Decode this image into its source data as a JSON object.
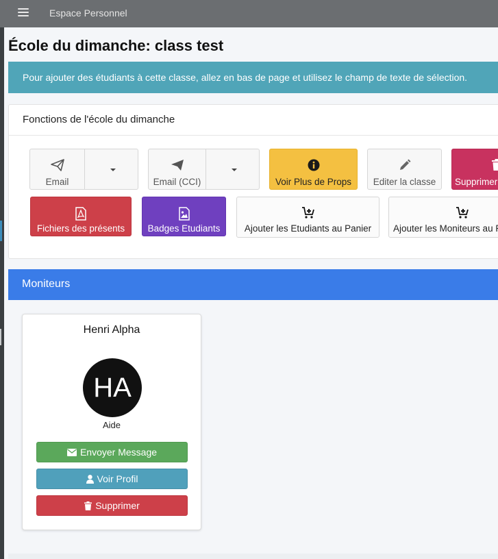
{
  "topbar": {
    "menu_icon": "hamburger-icon",
    "title": "Espace Personnel"
  },
  "page": {
    "title": "École du dimanche: class test"
  },
  "alert": {
    "text": "Pour ajouter des étudiants à cette classe, allez en bas de page et utilisez le champ de texte de sélection."
  },
  "functions": {
    "header": "Fonctions de l'école du dimanche",
    "buttons": {
      "email": {
        "label": "Email",
        "icon": "paper-plane-outline-icon"
      },
      "email_cci": {
        "label": "Email (CCI)",
        "icon": "paper-plane-icon"
      },
      "voir_props": {
        "label": "Voir Plus de Props",
        "icon": "info-circle-icon",
        "color": "#f4c041"
      },
      "editer": {
        "label": "Editer la classe",
        "icon": "pencil-icon"
      },
      "supprimer": {
        "label": "Supprimer",
        "icon": "trash-icon",
        "color": "#c8325f"
      },
      "fichiers": {
        "label": "Fichiers des présents",
        "icon": "file-pdf-icon",
        "color": "#cd4049"
      },
      "badges": {
        "label": "Badges Etudiants",
        "icon": "image-file-icon",
        "color": "#6f40bf"
      },
      "ajouter_etudiants": {
        "label": "Ajouter les Etudiants au Panier",
        "icon": "cart-plus-icon"
      },
      "ajouter_moniteurs": {
        "label": "Ajouter les Moniteurs au Panier",
        "icon": "cart-plus-icon"
      }
    }
  },
  "moniteurs": {
    "header": "Moniteurs",
    "color": "#3a7ce8",
    "members": [
      {
        "name": "Henri Alpha",
        "initials": "HA",
        "role": "Aide",
        "send_label": "Envoyer Message",
        "profile_label": "Voir Profil",
        "delete_label": "Supprimer"
      }
    ]
  }
}
